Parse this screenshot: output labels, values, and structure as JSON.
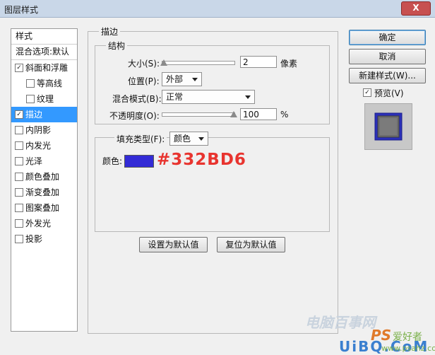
{
  "window": {
    "title": "图层样式",
    "close_label": "X"
  },
  "left_panel": {
    "header": "样式",
    "blend_options": "混合选项:默认",
    "items": [
      {
        "label": "斜面和浮雕",
        "checked": true,
        "indent": false
      },
      {
        "label": "等高线",
        "checked": false,
        "indent": true
      },
      {
        "label": "纹理",
        "checked": false,
        "indent": true
      },
      {
        "label": "描边",
        "checked": true,
        "indent": false,
        "selected": true
      },
      {
        "label": "内阴影",
        "checked": false
      },
      {
        "label": "内发光",
        "checked": false
      },
      {
        "label": "光泽",
        "checked": false
      },
      {
        "label": "颜色叠加",
        "checked": false
      },
      {
        "label": "渐变叠加",
        "checked": false
      },
      {
        "label": "图案叠加",
        "checked": false
      },
      {
        "label": "外发光",
        "checked": false
      },
      {
        "label": "投影",
        "checked": false
      }
    ]
  },
  "stroke": {
    "section_title": "描边",
    "structure_title": "结构",
    "size_label": "大小(S):",
    "size_value": "2",
    "size_unit": "像素",
    "position_label": "位置(P):",
    "position_value": "外部",
    "blend_label": "混合模式(B):",
    "blend_value": "正常",
    "opacity_label": "不透明度(O):",
    "opacity_value": "100",
    "opacity_unit": "%",
    "fill_type_label": "填充类型(F):",
    "fill_type_value": "颜色",
    "color_label": "颜色:",
    "color_hex": "#332BD6",
    "color_annotation": "#332BD6",
    "set_default_button": "设置为默认值",
    "reset_default_button": "复位为默认值"
  },
  "right_panel": {
    "ok_button": "确定",
    "cancel_button": "取消",
    "new_style_button": "新建样式(W)...",
    "preview_label": "预览(V)",
    "preview_checked": true
  },
  "watermark": {
    "site": "电脑百事网",
    "ps": "PS",
    "ps_suffix": "爱好者",
    "uibq": "UiBQ.CoM",
    "url": "www.psahz.com"
  },
  "colors": {
    "selection": "#3399ff",
    "stroke_color": "#332BD6",
    "annotation": "#e8342f"
  }
}
